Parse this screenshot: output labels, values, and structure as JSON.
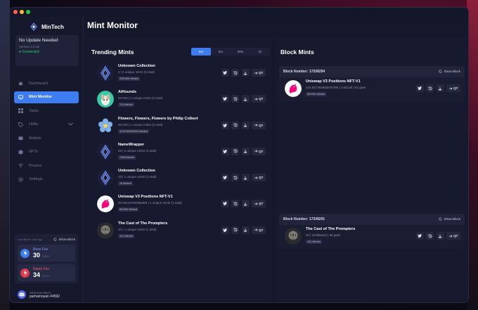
{
  "app": {
    "name": "MinTech"
  },
  "status": {
    "title": "No Update Needed",
    "version": "Version 2.0.18",
    "connection": "Connected"
  },
  "nav": [
    {
      "label": "Dashboard",
      "icon": "home-icon",
      "active": false
    },
    {
      "label": "Mint Monitor",
      "icon": "monitor-icon",
      "active": true
    },
    {
      "label": "Tasks",
      "icon": "grid-icon",
      "active": false
    },
    {
      "label": "Utility",
      "icon": "tag-icon",
      "active": false,
      "dropdown": true
    },
    {
      "label": "Wallets",
      "icon": "wallet-icon",
      "active": false
    },
    {
      "label": "NFTs",
      "icon": "nft-icon",
      "active": false
    },
    {
      "label": "Proxies",
      "icon": "wifi-icon",
      "active": false
    },
    {
      "label": "Settings",
      "icon": "gear-icon",
      "active": false
    }
  ],
  "fees": {
    "last_block": "Last Block: 16s ago",
    "show_block": "Show Block",
    "base": {
      "label": "Base Fee",
      "value": "30",
      "unit": "Gwei",
      "color": "#3d7cf1"
    },
    "rapid": {
      "label": "Rapid Fee",
      "value": "34",
      "unit": "Gwei",
      "color": "#e2394b"
    }
  },
  "user": {
    "welcome": "Welcome Back,",
    "name": "parhamoyan #4592"
  },
  "page": {
    "title": "Mint Monitor"
  },
  "trending": {
    "title": "Trending Mints",
    "tabs": [
      "5m",
      "5m",
      "30m",
      "1h"
    ],
    "items": [
      {
        "name": "Unknown Collection",
        "stats": "2 | 2 unique mints (3 total)",
        "badge": "2059389 Minted",
        "avatar": "eth"
      },
      {
        "name": "AiHounds",
        "stats": "20.002 | 1 unique mints (2 total)",
        "badge": "723 Minted",
        "avatar": "hound"
      },
      {
        "name": "Flowers, Flowers, Flowers by Philip Colbert",
        "stats": "20.029 | 1 unique mints (2 total)",
        "badge": "1275760000000 Minted",
        "avatar": "flower"
      },
      {
        "name": "NameWrapper",
        "stats": "28 | 2 unique mints (2 total)",
        "badge": "7298 Minted",
        "avatar": "eth"
      },
      {
        "name": "Unknown Collection",
        "stats": "23 | 1 unique mints (1 total)",
        "badge": "15 Minted",
        "avatar": "eth"
      },
      {
        "name": "Uniswap V3 Positions NFT-V1",
        "stats": "20.00123760058380 | 1 unique mints (1 total)",
        "badge": "502390 Minted",
        "avatar": "uni"
      },
      {
        "name": "The Cast of The Prompters",
        "stats": "20 | 1 unique mints (1 total)",
        "badge": "101 Minted",
        "avatar": "prompt"
      }
    ],
    "qt_label": "QT"
  },
  "blocks": {
    "title": "Block Mints",
    "show_label": "Show Block",
    "cards": [
      {
        "number": "Block Number: 17208294",
        "name": "Uniswap V3 Positions NFT-V1",
        "stats": "216.837394883670495 | multicall | 83 gwei",
        "badge": "502391 Minted",
        "avatar": "uni"
      },
      {
        "number": "Block Number: 17208291",
        "name": "The Cast of The Prompters",
        "stats": "20 | mintBased | 98 gwei",
        "badge": "101 Minted",
        "avatar": "prompt"
      }
    ]
  }
}
